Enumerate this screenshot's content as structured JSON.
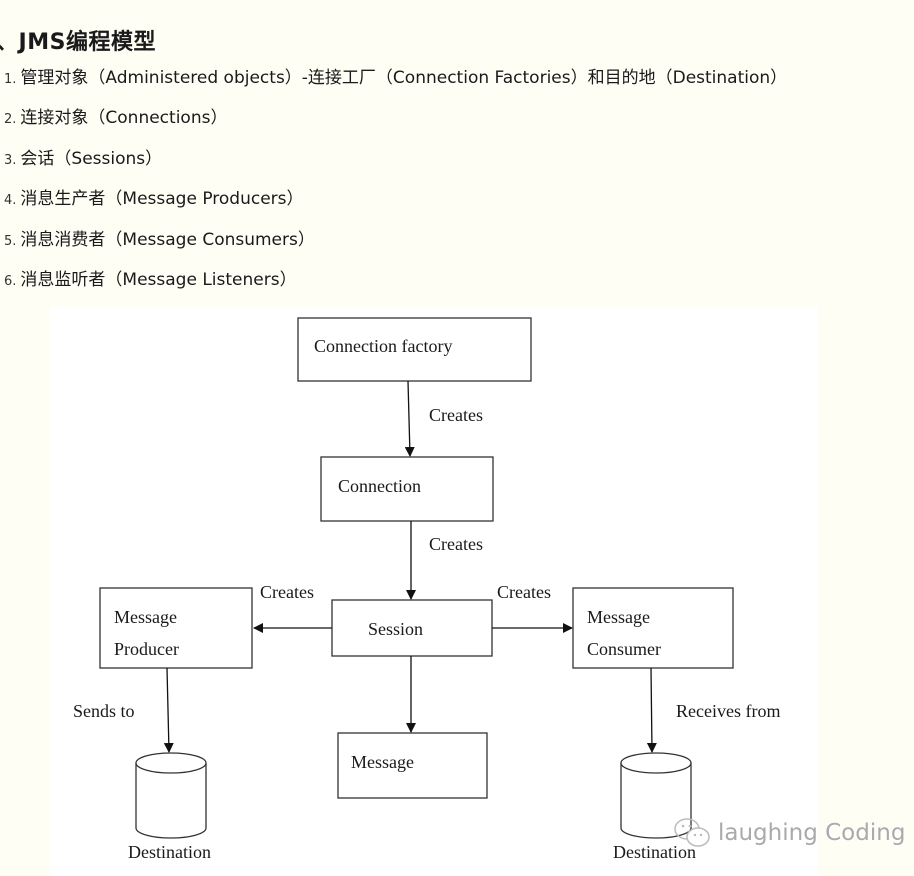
{
  "heading": {
    "prefix": "、",
    "title": "JMS编程模型"
  },
  "list": [
    {
      "num": "1.",
      "text": "管理对象（Administered objects）-连接工厂（Connection Factories）和目的地（Destination）"
    },
    {
      "num": "2.",
      "text": "连接对象（Connections）"
    },
    {
      "num": "3.",
      "text": "会话（Sessions）"
    },
    {
      "num": "4.",
      "text": "消息生产者（Message Producers）"
    },
    {
      "num": "5.",
      "text": "消息消费者（Message Consumers）"
    },
    {
      "num": "6.",
      "text": "消息监听者（Message Listeners）"
    }
  ],
  "diagram": {
    "nodes": {
      "connection_factory": "Connection factory",
      "connection": "Connection",
      "session": "Session",
      "producer_line1": "Message",
      "producer_line2": "Producer",
      "consumer_line1": "Message",
      "consumer_line2": "Consumer",
      "message": "Message",
      "destination_left": "Destination",
      "destination_right": "Destination"
    },
    "edges": {
      "factory_to_connection": "Creates",
      "connection_to_session": "Creates",
      "session_to_producer": "Creates",
      "session_to_consumer": "Creates",
      "producer_to_destination": "Sends to",
      "consumer_from_destination": "Receives from"
    }
  },
  "watermark": {
    "icon": "wechat-icon",
    "text": "laughing Coding"
  }
}
